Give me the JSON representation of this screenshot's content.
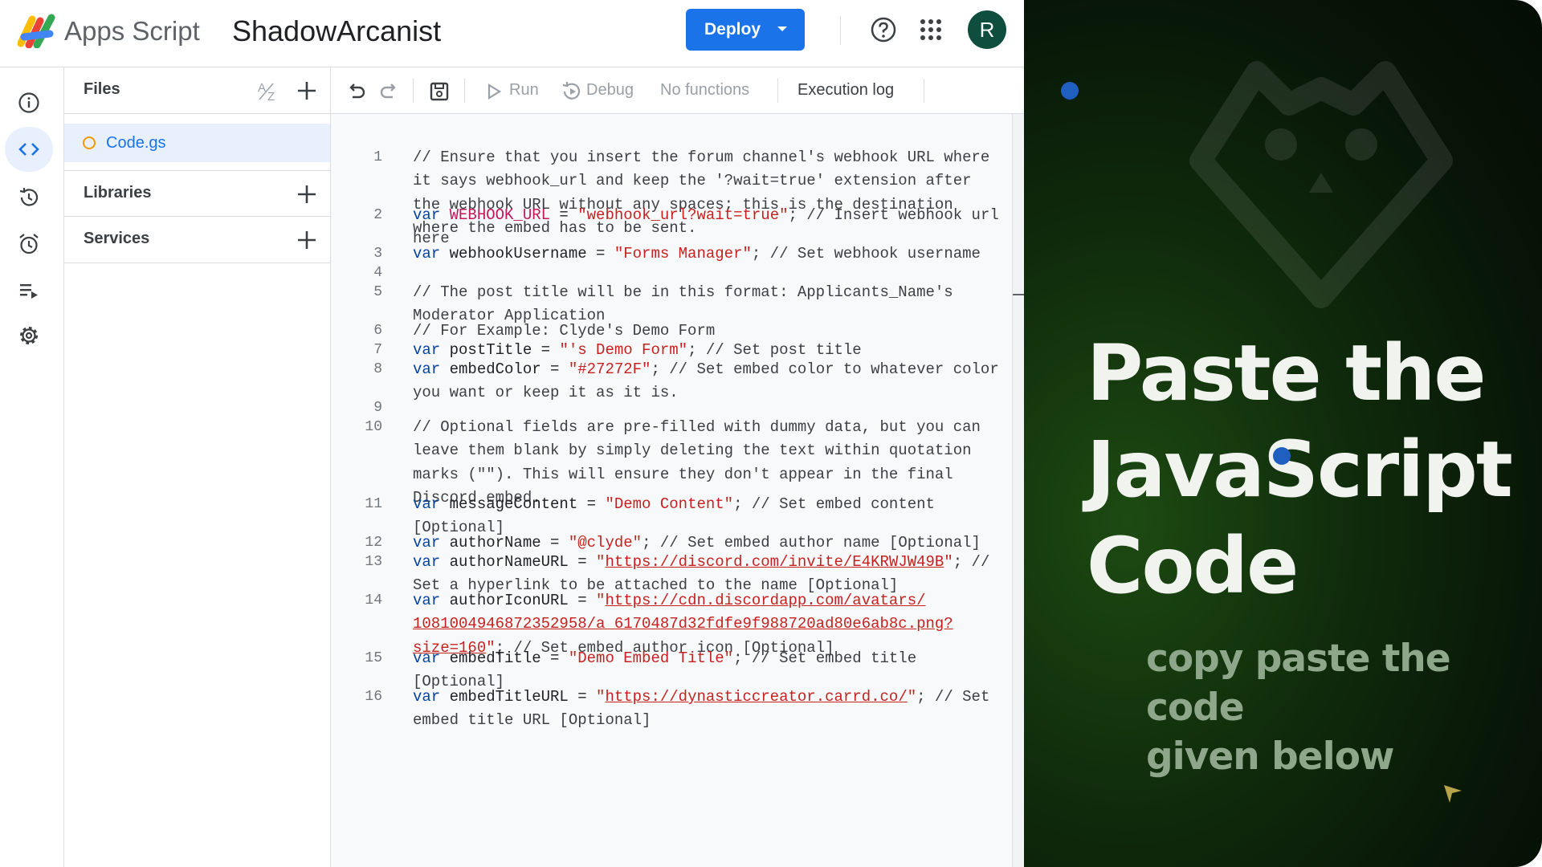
{
  "header": {
    "brand": "Apps Script",
    "project_name": "ShadowArcanist",
    "deploy_label": "Deploy",
    "avatar_initial": "R"
  },
  "rail": {
    "items": [
      "info-icon",
      "code-icon",
      "history-icon",
      "alarm-icon",
      "executions-icon",
      "settings-icon"
    ],
    "active": "code-icon"
  },
  "files_panel": {
    "files_title": "Files",
    "libraries_title": "Libraries",
    "services_title": "Services",
    "files": [
      {
        "name": "Code.gs"
      }
    ]
  },
  "toolbar": {
    "run_label": "Run",
    "debug_label": "Debug",
    "functions_label": "No functions",
    "execution_log_label": "Execution log"
  },
  "editor": {
    "lines": [
      {
        "n": "1",
        "segs": [
          {
            "t": "// Ensure that you insert the forum channel's webhook URL where it says webhook_url and keep the '?wait=true' extension after the webhook URL without any spaces; this is the destination where the embed has to be sent.",
            "c": "cm"
          }
        ]
      },
      {
        "n": "2",
        "segs": [
          {
            "t": "var ",
            "c": "kw"
          },
          {
            "t": "WEBHOOK_URL",
            "c": "pink"
          },
          {
            "t": " = ",
            "c": ""
          },
          {
            "t": "\"webhook_url?wait=true\"",
            "c": "str"
          },
          {
            "t": "; // Insert webhook url here",
            "c": "cm"
          }
        ]
      },
      {
        "n": "3",
        "segs": [
          {
            "t": "var ",
            "c": "kw"
          },
          {
            "t": "webhookUsername = ",
            "c": ""
          },
          {
            "t": "\"Forms Manager\"",
            "c": "str"
          },
          {
            "t": "; // Set webhook username",
            "c": "cm"
          }
        ]
      },
      {
        "n": "4",
        "segs": [
          {
            "t": "",
            "c": ""
          }
        ]
      },
      {
        "n": "5",
        "segs": [
          {
            "t": "// The post title will be in this format: Applicants_Name's Moderator Application",
            "c": "cm"
          }
        ]
      },
      {
        "n": "6",
        "segs": [
          {
            "t": "// For Example: Clyde's Demo Form",
            "c": "cm"
          }
        ]
      },
      {
        "n": "7",
        "segs": [
          {
            "t": "var ",
            "c": "kw"
          },
          {
            "t": "postTitle = ",
            "c": ""
          },
          {
            "t": "\"'s Demo Form\"",
            "c": "str"
          },
          {
            "t": "; // Set post title",
            "c": "cm"
          }
        ]
      },
      {
        "n": "8",
        "segs": [
          {
            "t": "var ",
            "c": "kw"
          },
          {
            "t": "embedColor = ",
            "c": ""
          },
          {
            "t": "\"#27272F\"",
            "c": "str"
          },
          {
            "t": "; // Set embed color to whatever color you want or keep it as it is.",
            "c": "cm"
          }
        ]
      },
      {
        "n": "9",
        "segs": [
          {
            "t": "",
            "c": ""
          }
        ]
      },
      {
        "n": "10",
        "segs": [
          {
            "t": "// Optional fields are pre-filled with dummy data, but you can leave them blank by simply deleting the text within quotation marks (\"\"). This will ensure they don't appear in the final Discord embed.",
            "c": "cm"
          }
        ]
      },
      {
        "n": "11",
        "segs": [
          {
            "t": "var ",
            "c": "kw"
          },
          {
            "t": "messageContent = ",
            "c": ""
          },
          {
            "t": "\"Demo Content\"",
            "c": "str"
          },
          {
            "t": "; // Set embed content [Optional]",
            "c": "cm"
          }
        ]
      },
      {
        "n": "12",
        "segs": [
          {
            "t": "var ",
            "c": "kw"
          },
          {
            "t": "authorName = ",
            "c": ""
          },
          {
            "t": "\"@clyde\"",
            "c": "str"
          },
          {
            "t": "; // Set embed author name [Optional]",
            "c": "cm"
          }
        ]
      },
      {
        "n": "13",
        "segs": [
          {
            "t": "var ",
            "c": "kw"
          },
          {
            "t": "authorNameURL = ",
            "c": ""
          },
          {
            "t": "\"",
            "c": "str"
          },
          {
            "t": "https://discord.com/invite/E4KRWJW49B",
            "c": "url"
          },
          {
            "t": "\"",
            "c": "str"
          },
          {
            "t": "; // Set a hyperlink to be attached to the name [Optional]",
            "c": "cm"
          }
        ]
      },
      {
        "n": "14",
        "segs": [
          {
            "t": "var ",
            "c": "kw"
          },
          {
            "t": "authorIconURL = ",
            "c": ""
          },
          {
            "t": "\"",
            "c": "str"
          },
          {
            "t": "https://cdn.discordapp.com/avatars/ 1081004946872352958/a_6170487d32fdfe9f988720ad80e6ab8c.png? size=160",
            "c": "url"
          },
          {
            "t": "\"",
            "c": "str"
          },
          {
            "t": "; // Set embed author icon [Optional]",
            "c": "cm"
          }
        ]
      },
      {
        "n": "15",
        "segs": [
          {
            "t": "var ",
            "c": "kw"
          },
          {
            "t": "embedTitle = ",
            "c": ""
          },
          {
            "t": "\"Demo Embed Title\"",
            "c": "str"
          },
          {
            "t": "; // Set embed title [Optional]",
            "c": "cm"
          }
        ]
      },
      {
        "n": "16",
        "segs": [
          {
            "t": "var ",
            "c": "kw"
          },
          {
            "t": "embedTitleURL = ",
            "c": ""
          },
          {
            "t": "\"",
            "c": "str"
          },
          {
            "t": "https://dynasticcreator.carrd.co/",
            "c": "url"
          },
          {
            "t": "\"",
            "c": "str"
          },
          {
            "t": "; // Set embed title URL [Optional]",
            "c": "cm"
          }
        ]
      }
    ]
  },
  "overlay": {
    "headline_lines": [
      "Paste the",
      "JavaScript",
      "Code"
    ],
    "subtitle_lines": [
      "copy paste the code",
      "given below"
    ]
  },
  "colors": {
    "accent": "#1a73e8",
    "keyword": "#0842a0",
    "string": "#c5221f",
    "constant": "#c2185b",
    "file_dot": "#f29900",
    "headline": "#f1f3ef",
    "subtitle": "#8ea78a"
  }
}
